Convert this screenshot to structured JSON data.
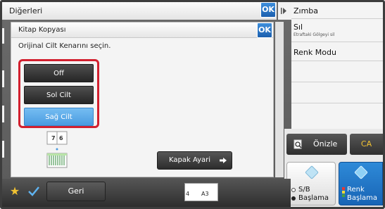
{
  "header": {
    "title": "Diğerleri",
    "ok_label": "OK"
  },
  "dialog": {
    "title": "Kitap Kopyası",
    "ok_label": "OK",
    "instruction": "Orijinal Cilt Kenarını seçin.",
    "options": [
      {
        "label": "Off",
        "selected": false
      },
      {
        "label": "Sol Cilt",
        "selected": false
      },
      {
        "label": "Sağ Cilt",
        "selected": true
      }
    ],
    "diagram_page_numbers": [
      "7",
      "6"
    ],
    "cover_button_label": "Kapak Ayari",
    "cover_button_icon": "arrow-right-icon"
  },
  "right_panel": {
    "items": [
      {
        "label": "Zımba",
        "sub": ""
      },
      {
        "label": "Sıl",
        "sub": "Etraftaki Gölgeyi sil"
      },
      {
        "label": "Renk Modu",
        "sub": ""
      }
    ],
    "preview_label": "Önizle",
    "preview_icon": "magnifier-document-icon",
    "ca_label": "CA",
    "bw_start": {
      "line1": "S/B",
      "line2": "Başlama"
    },
    "color_start": {
      "line1": "Renk",
      "line2": "Başlama"
    }
  },
  "bottom_bar": {
    "back_label": "Geri",
    "paper_tray_number": "4",
    "paper_size": "A3",
    "favorite_icon": "star-icon",
    "check_icon": "checkmark-icon"
  },
  "colors": {
    "selected_option": "#5aa9e8",
    "highlight_border": "#d2202f",
    "ok_button": "#2a74c6",
    "ca_text": "#f1c232",
    "color_start": "#1f72c4"
  }
}
